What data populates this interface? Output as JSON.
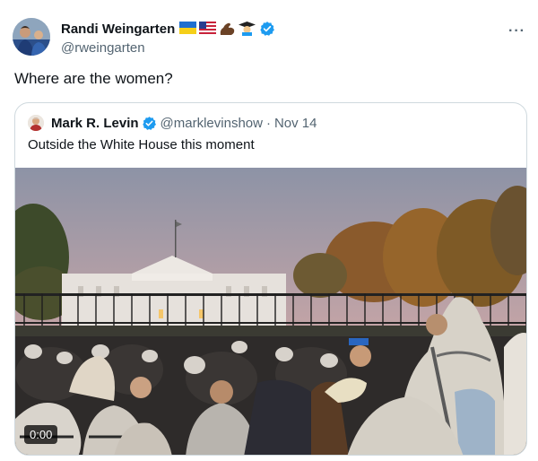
{
  "tweet": {
    "author": {
      "display_name": "Randi Weingarten",
      "handle": "@rweingarten",
      "badges": [
        "ukraine-flag-icon",
        "us-flag-icon",
        "flexed-biceps-icon",
        "graduate-icon"
      ],
      "verified": true,
      "avatar_icon": "avatar"
    },
    "more_label": "···",
    "text": "Where are the women?",
    "quote": {
      "author": {
        "display_name": "Mark R. Levin",
        "handle": "@marklevinshow",
        "verified": true
      },
      "dot": "·",
      "date": "Nov 14",
      "text": "Outside the White House this moment",
      "video": {
        "timer": "0:00"
      }
    }
  },
  "colors": {
    "verified_blue": "#1d9bf0",
    "text_primary": "#0f1419",
    "text_secondary": "#536471",
    "border": "#cfd9de"
  }
}
